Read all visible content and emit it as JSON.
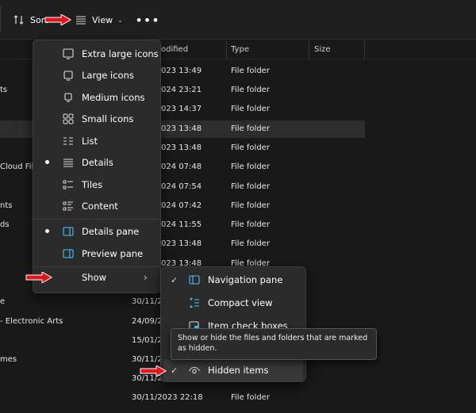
{
  "toolbar": {
    "sort_label": "Sort",
    "view_label": "View"
  },
  "columns": {
    "modified": "odified",
    "type": "Type",
    "size": "Size"
  },
  "rows": [
    {
      "name": "",
      "date": "023 13:49",
      "type": "File folder"
    },
    {
      "name": "ts",
      "date": "024 23:21",
      "type": "File folder"
    },
    {
      "name": "",
      "date": "023 14:37",
      "type": "File folder"
    },
    {
      "name": "",
      "date": "023 13:48",
      "type": "File folder"
    },
    {
      "name": "",
      "date": "023 13:48",
      "type": "File folder"
    },
    {
      "name": "Cloud File",
      "date": "024 07:48",
      "type": "File folder"
    },
    {
      "name": "",
      "date": "024 07:54",
      "type": "File folder"
    },
    {
      "name": "nts",
      "date": "024 07:42",
      "type": "File folder"
    },
    {
      "name": "ds",
      "date": "024 11:55",
      "type": "File folder"
    },
    {
      "name": "",
      "date": "023 13:48",
      "type": "File folder"
    },
    {
      "name": "",
      "date": "023 13:48",
      "type": "File folder"
    },
    {
      "name": "",
      "date": "",
      "type": ""
    },
    {
      "name": "e",
      "date": "30/11/2",
      "type": ""
    },
    {
      "name": "- Electronic Arts",
      "date": "24/09/2",
      "type": ""
    },
    {
      "name": "",
      "date": "15/01/2",
      "type": ""
    },
    {
      "name": "mes",
      "date": "30/11/2",
      "type": ""
    },
    {
      "name": "",
      "date": "30/11/2",
      "type": ""
    },
    {
      "name": "",
      "date": "30/11/2023 22:18",
      "type": "File folder"
    }
  ],
  "view_menu": {
    "items": [
      {
        "label": "Extra large icons",
        "icon": "monitor-large-icon",
        "selected": false
      },
      {
        "label": "Large icons",
        "icon": "monitor-icon",
        "selected": false
      },
      {
        "label": "Medium icons",
        "icon": "monitor-medium-icon",
        "selected": false
      },
      {
        "label": "Small icons",
        "icon": "small-grid-icon",
        "selected": false
      },
      {
        "label": "List",
        "icon": "list-icon",
        "selected": false
      },
      {
        "label": "Details",
        "icon": "details-icon",
        "selected": true
      },
      {
        "label": "Tiles",
        "icon": "tiles-icon",
        "selected": false
      },
      {
        "label": "Content",
        "icon": "content-icon",
        "selected": false
      },
      {
        "label": "Details pane",
        "icon": "details-pane-icon",
        "selected": true
      },
      {
        "label": "Preview pane",
        "icon": "preview-pane-icon",
        "selected": false
      },
      {
        "label": "Show",
        "icon": "",
        "selected": false
      }
    ]
  },
  "show_submenu": {
    "items": [
      {
        "label": "Navigation pane",
        "icon": "navigation-pane-icon",
        "checked": true
      },
      {
        "label": "Compact view",
        "icon": "compact-view-icon",
        "checked": false
      },
      {
        "label": "Item check boxes",
        "icon": "item-check-boxes-icon",
        "checked": false
      },
      {
        "label": "Hidden items",
        "icon": "eye-icon",
        "checked": true
      }
    ]
  },
  "tooltip": {
    "text": "Show or hide the files and folders that are marked as hidden."
  },
  "colors": {
    "arrow": "#e0161c",
    "accent": "#4cc2ff",
    "menu_bg": "#2b2b2b"
  }
}
